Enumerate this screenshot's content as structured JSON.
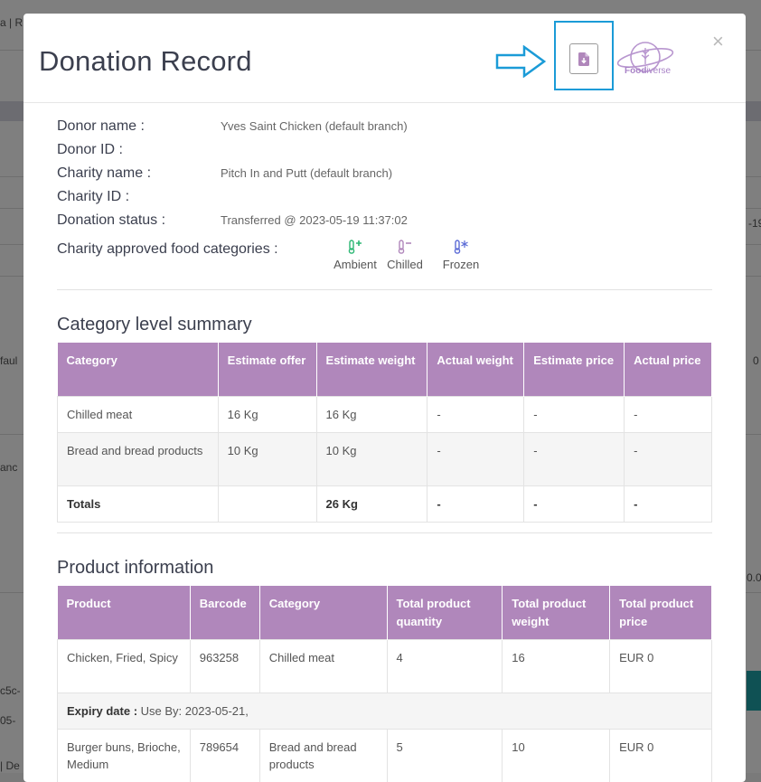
{
  "background_fragments": {
    "top_left": "a | R",
    "date_right": "-19",
    "left_default": "faul",
    "right_zero": "0",
    "left_anc": "anc",
    "right_amount": "0.0",
    "left_c5c": "c5c-",
    "left_date": "05-",
    "bottom_left": "| De"
  },
  "modal": {
    "title": "Donation Record",
    "close_label": "×",
    "logo_text_bold": "Food",
    "logo_text_light": "iverse"
  },
  "donor_info": {
    "donor_name_label": "Donor name :",
    "donor_name_value": "Yves Saint Chicken (default branch)",
    "donor_id_label": "Donor ID :",
    "charity_name_label": "Charity name :",
    "charity_name_value": "Pitch In and Putt (default branch)",
    "charity_id_label": "Charity ID :",
    "status_label": "Donation status :",
    "status_value": "Transferred @ 2023-05-19 11:37:02",
    "categories_label": "Charity approved food categories :",
    "categories": [
      {
        "label": "Ambient",
        "icon": "thermometer-plus-icon",
        "color": "#2bb673"
      },
      {
        "label": "Chilled",
        "icon": "thermometer-minus-icon",
        "color": "#b087bb"
      },
      {
        "label": "Frozen",
        "icon": "thermometer-snow-icon",
        "color": "#5b6bd6"
      }
    ]
  },
  "category_summary": {
    "title": "Category level summary",
    "headers": [
      "Category",
      "Estimate offer",
      "Estimate weight",
      "Actual weight",
      "Estimate price",
      "Actual price"
    ],
    "rows": [
      [
        "Chilled meat",
        "16 Kg",
        "16 Kg",
        "-",
        "-",
        "-"
      ],
      [
        "Bread and bread products",
        "10 Kg",
        "10 Kg",
        "-",
        "-",
        "-"
      ]
    ],
    "totals": [
      "Totals",
      "",
      "26 Kg",
      "-",
      "-",
      "-"
    ]
  },
  "product_info": {
    "title": "Product information",
    "headers": [
      "Product",
      "Barcode",
      "Category",
      "Total product quantity",
      "Total product weight",
      "Total product price"
    ],
    "rows": [
      [
        "Chicken, Fried, Spicy",
        "963258",
        "Chilled meat",
        "4",
        "16",
        "EUR 0"
      ],
      [
        "Burger buns, Brioche, Medium",
        "789654",
        "Bread and bread products",
        "5",
        "10",
        "EUR 0"
      ]
    ],
    "expiry_label": "Expiry date :",
    "expiry_value": " Use By: 2023-05-21,"
  },
  "colors": {
    "header_purple": "#b087bb",
    "highlight_blue": "#1b9bd7",
    "logo_purple": "#a983c7"
  }
}
